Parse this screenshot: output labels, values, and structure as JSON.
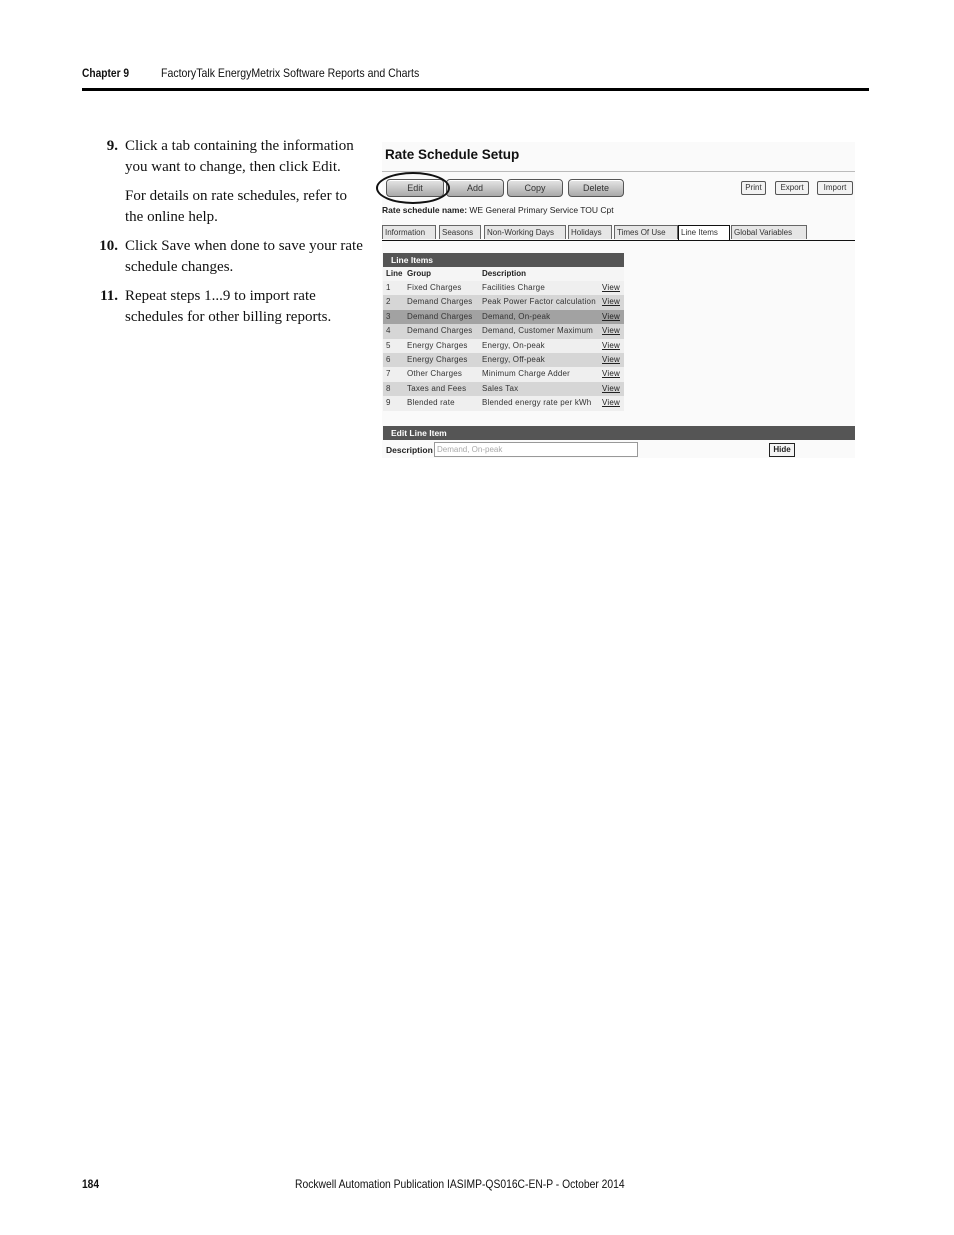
{
  "header": {
    "chapter": "Chapter 9",
    "title": "FactoryTalk EnergyMetrix Software Reports and Charts"
  },
  "steps": [
    {
      "number": "9.",
      "text": "Click a tab containing the information you want to change, then click Edit.",
      "sub": "For details on rate schedules, refer to the online help."
    },
    {
      "number": "10.",
      "text": "Click Save when done to save your rate schedule changes."
    },
    {
      "number": "11.",
      "text": "Repeat steps 1...9 to import rate schedules for other billing reports."
    }
  ],
  "screenshot": {
    "title": "Rate Schedule Setup",
    "buttons": {
      "edit": "Edit",
      "add": "Add",
      "copy": "Copy",
      "delete": "Delete",
      "print": "Print",
      "export": "Export",
      "import": "Import"
    },
    "rate_schedule_label": "Rate schedule name:",
    "rate_schedule_value": "WE General Primary Service TOU Cpt",
    "tabs": [
      {
        "label": "Information",
        "active": false
      },
      {
        "label": "Seasons",
        "active": false
      },
      {
        "label": "Non-Working Days",
        "active": false
      },
      {
        "label": "Holidays",
        "active": false
      },
      {
        "label": "Times Of Use",
        "active": false
      },
      {
        "label": "Line Items",
        "active": true
      },
      {
        "label": "Global Variables",
        "active": false
      }
    ],
    "line_items": {
      "header": "Line Items",
      "columns": {
        "line": "Line",
        "group": "Group",
        "description": "Description"
      },
      "rows": [
        {
          "line": "1",
          "group": "Fixed Charges",
          "description": "Facilities Charge",
          "action": "View"
        },
        {
          "line": "2",
          "group": "Demand Charges",
          "description": "Peak Power Factor calculation",
          "action": "View"
        },
        {
          "line": "3",
          "group": "Demand Charges",
          "description": "Demand, On-peak",
          "action": "View",
          "selected": true
        },
        {
          "line": "4",
          "group": "Demand Charges",
          "description": "Demand, Customer Maximum",
          "action": "View"
        },
        {
          "line": "5",
          "group": "Energy Charges",
          "description": "Energy, On-peak",
          "action": "View"
        },
        {
          "line": "6",
          "group": "Energy Charges",
          "description": "Energy, Off-peak",
          "action": "View"
        },
        {
          "line": "7",
          "group": "Other Charges",
          "description": "Minimum Charge Adder",
          "action": "View"
        },
        {
          "line": "8",
          "group": "Taxes and Fees",
          "description": "Sales Tax",
          "action": "View"
        },
        {
          "line": "9",
          "group": "Blended rate",
          "description": "Blended energy rate per kWh",
          "action": "View"
        }
      ]
    },
    "edit_line_item": {
      "header": "Edit Line Item",
      "description_label": "Description",
      "description_value": "Demand, On-peak",
      "hide_label": "Hide"
    }
  },
  "footer": {
    "page_number": "184",
    "publication": "Rockwell Automation Publication IASIMP-QS016C-EN-P - October 2014"
  }
}
